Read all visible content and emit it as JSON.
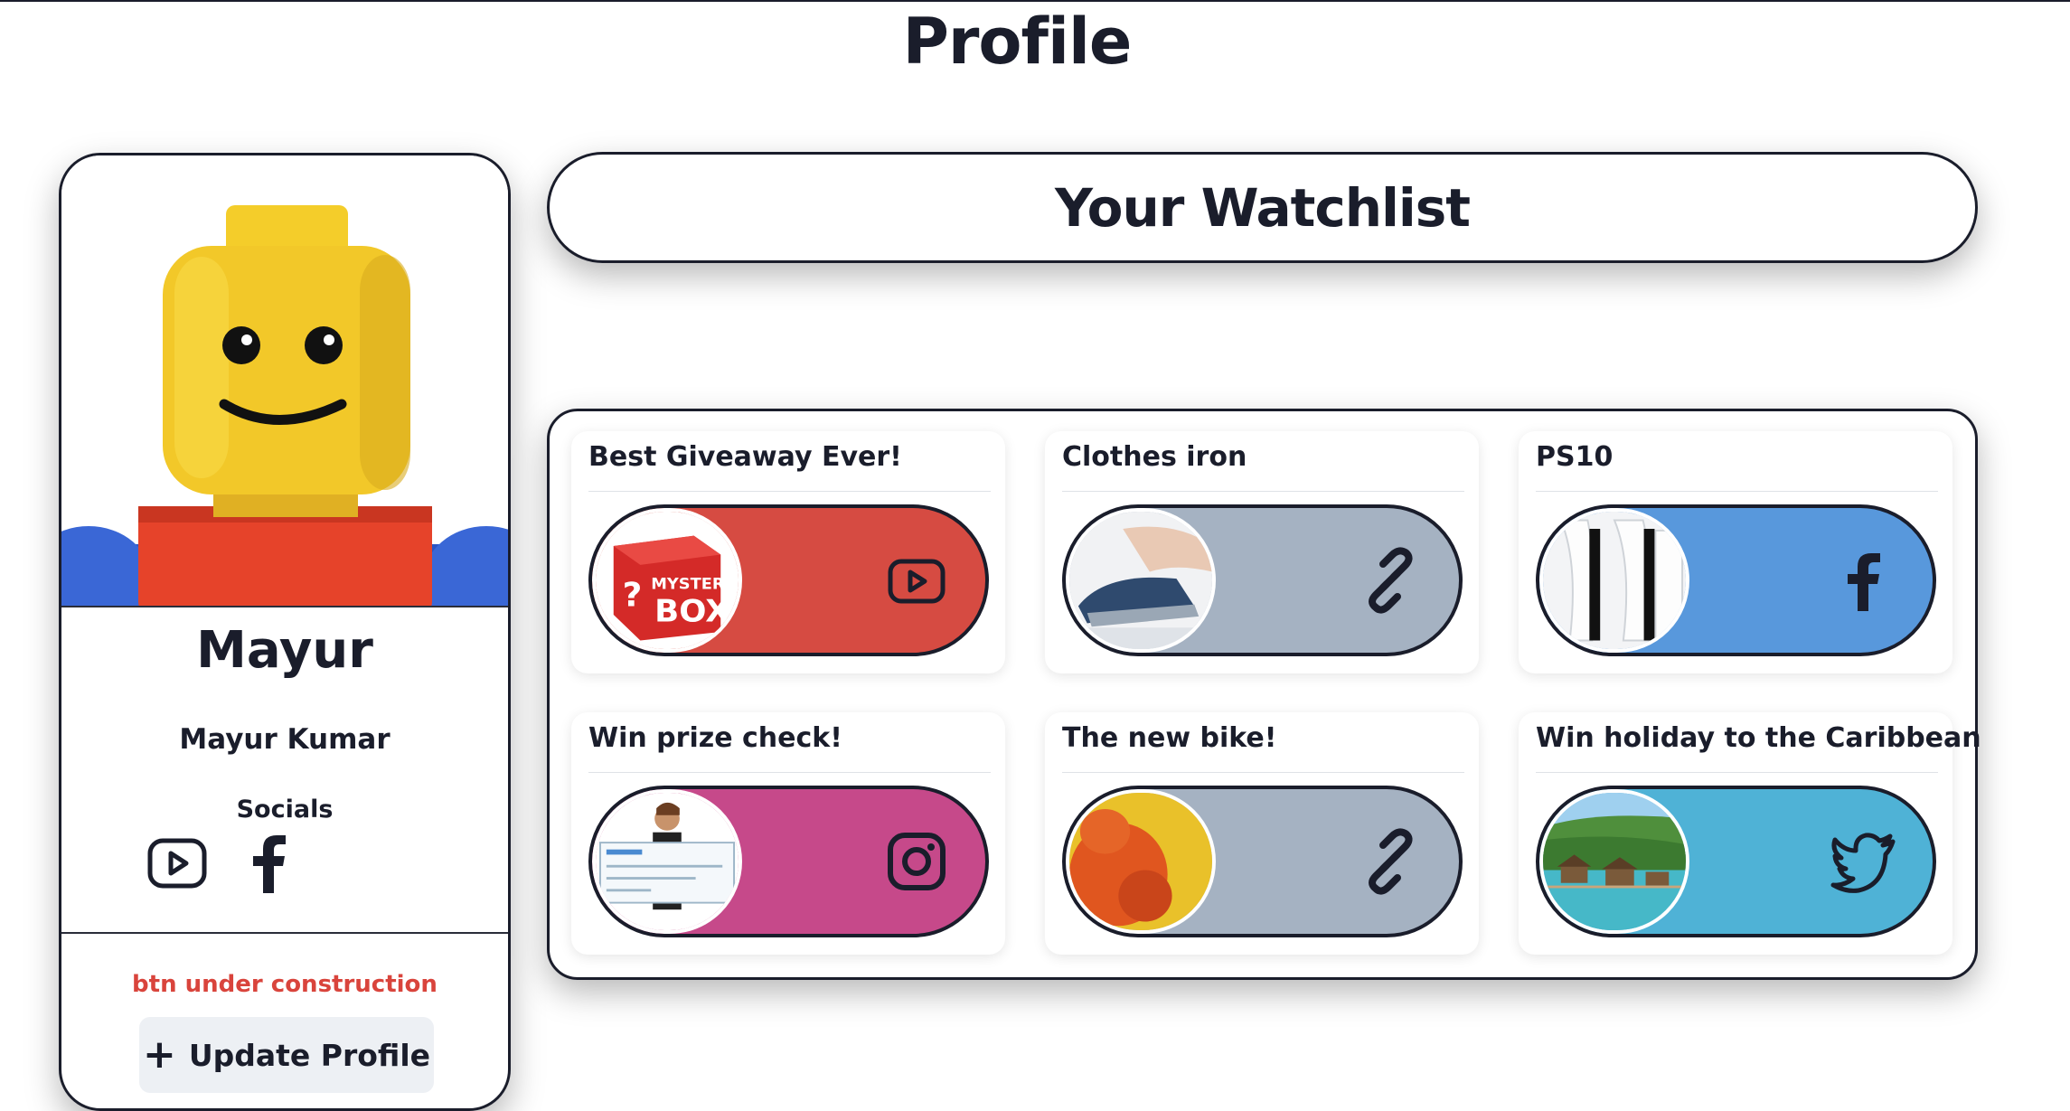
{
  "page": {
    "title": "Profile"
  },
  "profile": {
    "display_name": "Mayur",
    "full_name": "Mayur Kumar",
    "socials_label": "Socials",
    "socials": [
      {
        "icon": "youtube-icon"
      },
      {
        "icon": "facebook-icon"
      }
    ],
    "construction_note": "btn under construction",
    "update_button": {
      "label": "Update Profile",
      "icon": "plus-icon"
    }
  },
  "watchlist": {
    "title": "Your Watchlist",
    "items": [
      {
        "title": "Best Giveaway Ever!",
        "color": "#d64b42",
        "platform_icon": "youtube-icon",
        "thumbnail": "mystery-box"
      },
      {
        "title": "Clothes iron",
        "color": "#a5b2c2",
        "platform_icon": "link-icon",
        "thumbnail": "clothes-iron"
      },
      {
        "title": "PS10",
        "color": "#5898dc",
        "platform_icon": "facebook-icon",
        "thumbnail": "game-console"
      },
      {
        "title": "Win prize check!",
        "color": "#c6498a",
        "platform_icon": "instagram-icon",
        "thumbnail": "prize-check"
      },
      {
        "title": "The new bike!",
        "color": "#a5b2c2",
        "platform_icon": "link-icon",
        "thumbnail": "orange-figure"
      },
      {
        "title": "Win holiday to the Caribbean",
        "color": "#4fb2d6",
        "platform_icon": "twitter-icon",
        "thumbnail": "caribbean-resort"
      }
    ]
  },
  "colors": {
    "text": "#1a1d2b",
    "warning": "#d9443c",
    "button_bg": "#edf0f4"
  }
}
